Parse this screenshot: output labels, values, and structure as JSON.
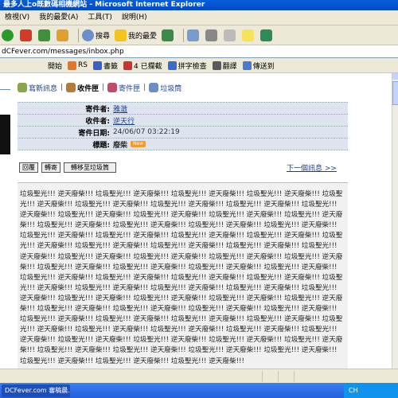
{
  "window": {
    "title": "最多人上o既數碼相機網站 - Microsoft Internet Explorer"
  },
  "menu": [
    "檢視(V)",
    "我的最愛(A)",
    "工具(T)",
    "說明(H)"
  ],
  "toolbar": {
    "search_label": "搜尋",
    "favorites_label": "我的最愛"
  },
  "address": {
    "value": "dCFever.com/messages/inbox.php"
  },
  "links": [
    "開始",
    "RS",
    "書籤",
    "4 已攔截",
    "拼字檢查",
    "翻譯",
    "傳送到"
  ],
  "tabs": [
    {
      "label": "寫新訊息",
      "active": false
    },
    {
      "label": "收件匣",
      "active": true
    },
    {
      "label": "寄件匣",
      "active": false
    },
    {
      "label": "垃圾筒",
      "active": false
    }
  ],
  "message": {
    "sender_label": "寄件者:",
    "sender": "雅澂",
    "recipient_label": "收件者:",
    "recipient": "逆天行",
    "date_label": "寄件日期:",
    "date": "24/06/07 03:22:19",
    "subject_label": "標題:",
    "subject": "廢柴",
    "badge": "New"
  },
  "actions": {
    "reply": "回覆",
    "forward": "轉寄",
    "move_trash": "轉移至垃圾筒",
    "next": "下一個訊息 >>"
  },
  "body_text": "垃圾聖光!!! 逆天廢柴!!! 垃圾聖光!!! 逆天廢柴!!! 垃圾聖光!!! 逆天廢柴!!! 垃圾聖光!!! 逆天廢柴!!! 垃圾聖光!!! 逆天廢柴!!! 垃圾聖光!!! 逆天廢柴!!! 垃圾聖光!!! 逆天廢柴!!! 垃圾聖光!!! 逆天廢柴!!! 垃圾聖光!!! 逆天廢柴!!! 垃圾聖光!!! 逆天廢柴!!! 垃圾聖光!!! 逆天廢柴!!! 垃圾聖光!!! 逆天廢柴!!! 垃圾聖光!!! 逆天廢柴!!! 垃圾聖光!!! 逆天廢柴!!! 垃圾聖光!!! 逆天廢柴!!! 垃圾聖光!!! 逆天廢柴!!! 垃圾聖光!!! 逆天廢柴!!! 垃圾聖光!!! 逆天廢柴!!! 垃圾聖光!!! 逆天廢柴!!! 垃圾聖光!!! 逆天廢柴!!! 垃圾聖光!!! 逆天廢柴!!! 垃圾聖光!!! 逆天廢柴!!! 垃圾聖光!!! 逆天廢柴!!! 垃圾聖光!!! 逆天廢柴!!! 垃圾聖光!!! 逆天廢柴!!! 垃圾聖光!!! 逆天廢柴!!! 垃圾聖光!!! 逆天廢柴!!! 垃圾聖光!!! 逆天廢柴!!! 垃圾聖光!!! 逆天廢柴!!! 垃圾聖光!!! 逆天廢柴!!! 垃圾聖光!!! 逆天廢柴!!! 垃圾聖光!!! 逆天廢柴!!! 垃圾聖光!!! 逆天廢柴!!! 垃圾聖光!!! 逆天廢柴!!! 垃圾聖光!!! 逆天廢柴!!! 垃圾聖光!!! 逆天廢柴!!! 垃圾聖光!!! 逆天廢柴!!! 垃圾聖光!!! 逆天廢柴!!! 垃圾聖光!!! 逆天廢柴!!! 垃圾聖光!!! 逆天廢柴!!! 垃圾聖光!!! 逆天廢柴!!! 垃圾聖光!!! 逆天廢柴!!! 垃圾聖光!!! 逆天廢柴!!! 垃圾聖光!!! 逆天廢柴!!! 垃圾聖光!!! 逆天廢柴!!! 垃圾聖光!!! 逆天廢柴!!! 垃圾聖光!!! 逆天廢柴!!! 垃圾聖光!!! 逆天廢柴!!! 垃圾聖光!!! 逆天廢柴!!! 垃圾聖光!!! 逆天廢柴!!! 垃圾聖光!!! 逆天廢柴!!! 垃圾聖光!!! 逆天廢柴!!! 垃圾聖光!!! 逆天廢柴!!! 垃圾聖光!!! 逆天廢柴!!! 垃圾聖光!!! 逆天廢柴!!! 垃圾聖光!!! 逆天廢柴!!! 垃圾聖光!!! 逆天廢柴!!! 垃圾聖光!!! 逆天廢柴!!! 垃圾聖光!!! 逆天廢柴!!! 垃圾聖光!!! 逆天廢柴!!! 垃圾聖光!!! 逆天廢柴!!! 垃圾聖光!!! 逆天廢柴!!! 垃圾聖光!!! 逆天廢柴!!! 垃圾聖光!!! 逆天廢柴!!! 垃圾聖光!!! 逆天廢柴!!! 垃圾聖光!!! 逆天廢柴!!! 垃圾聖光!!! 逆天廢柴!!! 垃圾聖光!!! 逆天廢柴!!! 垃圾聖光!!! 逆天廢柴!!! 垃圾聖光!!! 逆天廢柴!!! 垃圾聖光!!! 逆天廢柴!!!",
  "taskbar": {
    "item": "DCFever.com 審稿晨...",
    "tray": "CH"
  }
}
